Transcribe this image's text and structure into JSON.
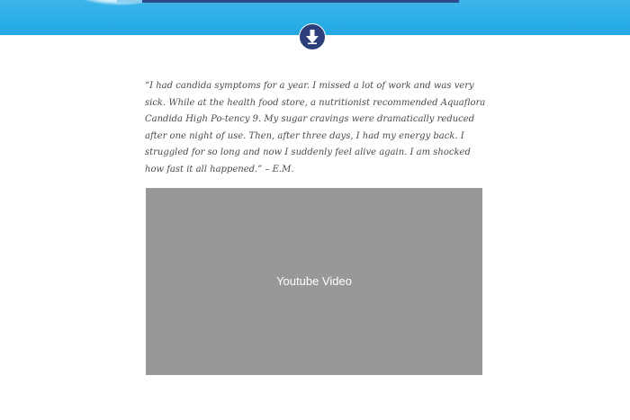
{
  "hero": {
    "accent_color": "#2aaee6",
    "strip_color": "#2f4a8a"
  },
  "scroll_button": {
    "icon": "arrow-down-icon",
    "color": "#2d3f7a"
  },
  "testimonial": {
    "text": "“I had candida symptoms for a year. I missed a lot of work and was very sick. While at the health food store, a nutritionist recommended Aquaflora Candida High Po-tency 9. My sugar cravings were dramatically reduced after one night of use. Then, after three days, I had my energy back. I struggled for so long and now I suddenly feel alive again. I am shocked how fast it all happened.” – E.M."
  },
  "video": {
    "label": "Youtube Video",
    "background_color": "#989898"
  }
}
